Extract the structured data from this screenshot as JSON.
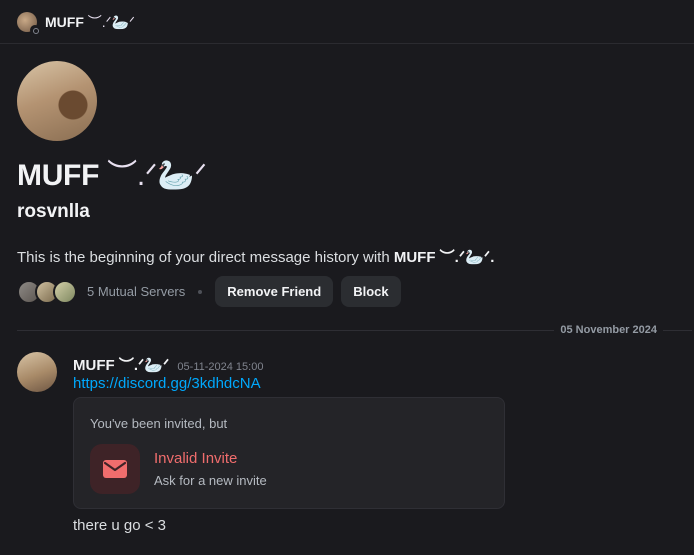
{
  "header": {
    "name": "MUFF",
    "name_decoration": "︶.ᐟ🦢ᐟ"
  },
  "profile": {
    "display_name": "MUFF",
    "display_decoration": "︶.ᐟ🦢ᐟ",
    "username": "rosvnlla",
    "intro_prefix": "This is the beginning of your direct message history with",
    "intro_name": "MUFF ︶.ᐟ🦢ᐟ.",
    "mutual_servers": "5 Mutual Servers",
    "remove_friend_label": "Remove Friend",
    "block_label": "Block"
  },
  "date_divider": "05 November 2024",
  "message": {
    "author": "MUFF ︶.ᐟ🦢ᐟ",
    "timestamp": "05-11-2024 15:00",
    "link": "https://discord.gg/3kdhdcNA",
    "invite": {
      "heading": "You've been invited, but",
      "title": "Invalid Invite",
      "subtitle": "Ask for a new invite",
      "icon": "envelope-icon",
      "accent": "#f06d6d"
    },
    "text": "there u go < 3"
  },
  "colors": {
    "background": "#1a1a1e",
    "link": "#00a8fc",
    "error": "#f06d6d",
    "button": "#2b2d31"
  }
}
